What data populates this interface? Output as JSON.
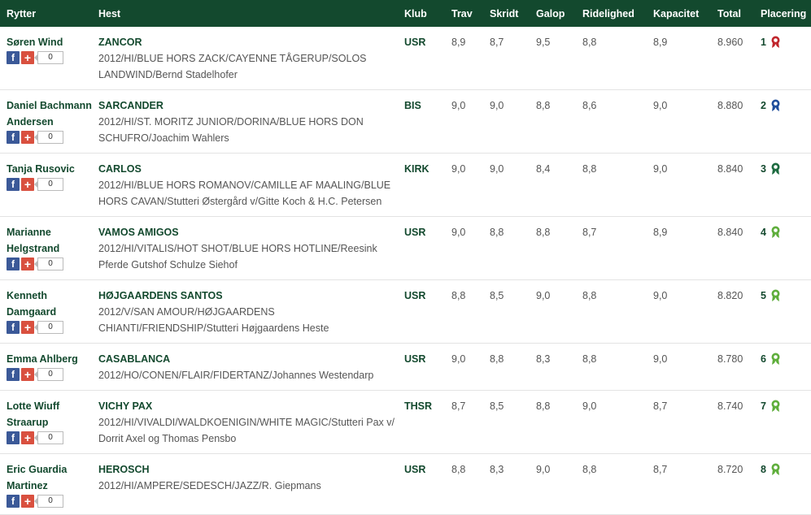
{
  "header": {
    "rider": "Rytter",
    "horse": "Hest",
    "club": "Klub",
    "trav": "Trav",
    "skridt": "Skridt",
    "galop": "Galop",
    "ridelighed": "Ridelighed",
    "kapacitet": "Kapacitet",
    "total": "Total",
    "placering": "Placering"
  },
  "rows": [
    {
      "rider": "Søren Wind",
      "share_count": "0",
      "horse": "ZANCOR",
      "desc": "2012/HI/BLUE HORS ZACK/CAYENNE TÅGERUP/SOLOS LANDWIND/Bernd Stadelhofer",
      "club": "USR",
      "trav": "8,9",
      "skridt": "8,7",
      "galop": "9,5",
      "ridelighed": "8,8",
      "kapacitet": "8,9",
      "total": "8.960",
      "place": "1",
      "rosette_color": "#c0272d"
    },
    {
      "rider": "Daniel Bachmann Andersen",
      "share_count": "0",
      "horse": "SARCANDER",
      "desc": "2012/HI/ST. MORITZ JUNIOR/DORINA/BLUE HORS DON SCHUFRO/Joachim Wahlers",
      "club": "BIS",
      "trav": "9,0",
      "skridt": "9,0",
      "galop": "8,8",
      "ridelighed": "8,6",
      "kapacitet": "9,0",
      "total": "8.880",
      "place": "2",
      "rosette_color": "#1f4e9c"
    },
    {
      "rider": "Tanja Rusovic",
      "share_count": "0",
      "horse": "CARLOS",
      "desc": "2012/HI/BLUE HORS ROMANOV/CAMILLE AF MAALING/BLUE HORS CAVAN/Stutteri Østergård v/Gitte Koch & H.C. Petersen",
      "club": "KIRK",
      "trav": "9,0",
      "skridt": "9,0",
      "galop": "8,4",
      "ridelighed": "8,8",
      "kapacitet": "9,0",
      "total": "8.840",
      "place": "3",
      "rosette_color": "#1e6b40"
    },
    {
      "rider": "Marianne Helgstrand",
      "share_count": "0",
      "horse": "VAMOS AMIGOS",
      "desc": "2012/HI/VITALIS/HOT SHOT/BLUE HORS HOTLINE/Reesink Pferde Gutshof Schulze Siehof",
      "club": "USR",
      "trav": "9,0",
      "skridt": "8,8",
      "galop": "8,8",
      "ridelighed": "8,7",
      "kapacitet": "8,9",
      "total": "8.840",
      "place": "4",
      "rosette_color": "#5fae3c"
    },
    {
      "rider": "Kenneth Damgaard",
      "share_count": "0",
      "horse": "HØJGAARDENS SANTOS",
      "desc": "2012/V/SAN AMOUR/HØJGAARDENS CHIANTI/FRIENDSHIP/Stutteri Højgaardens Heste",
      "club": "USR",
      "trav": "8,8",
      "skridt": "8,5",
      "galop": "9,0",
      "ridelighed": "8,8",
      "kapacitet": "9,0",
      "total": "8.820",
      "place": "5",
      "rosette_color": "#5fae3c"
    },
    {
      "rider": "Emma Ahlberg",
      "share_count": "0",
      "horse": "CASABLANCA",
      "desc": "2012/HO/CONEN/FLAIR/FIDERTANZ/Johannes Westendarp",
      "club": "USR",
      "trav": "9,0",
      "skridt": "8,8",
      "galop": "8,3",
      "ridelighed": "8,8",
      "kapacitet": "9,0",
      "total": "8.780",
      "place": "6",
      "rosette_color": "#5fae3c"
    },
    {
      "rider": "Lotte Wiuff Straarup",
      "share_count": "0",
      "horse": "VICHY PAX",
      "desc": "2012/HI/VIVALDI/WALDKOENIGIN/WHITE MAGIC/Stutteri Pax v/ Dorrit Axel og Thomas Pensbo",
      "club": "THSR",
      "trav": "8,7",
      "skridt": "8,5",
      "galop": "8,8",
      "ridelighed": "9,0",
      "kapacitet": "8,7",
      "total": "8.740",
      "place": "7",
      "rosette_color": "#5fae3c"
    },
    {
      "rider": "Eric Guardia Martinez",
      "share_count": "0",
      "horse": "HEROSCH",
      "desc": "2012/HI/AMPERE/SEDESCH/JAZZ/R. Giepmans",
      "club": "USR",
      "trav": "8,8",
      "skridt": "8,3",
      "galop": "9,0",
      "ridelighed": "8,8",
      "kapacitet": "8,7",
      "total": "8.720",
      "place": "8",
      "rosette_color": "#5fae3c"
    }
  ]
}
